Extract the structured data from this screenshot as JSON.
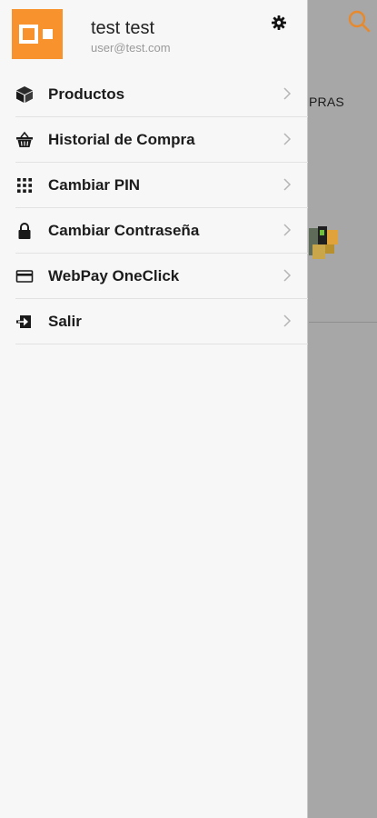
{
  "user": {
    "name": "test test",
    "email": "user@test.com"
  },
  "menu": [
    {
      "label": "Productos",
      "icon": "cube-icon"
    },
    {
      "label": "Historial de Compra",
      "icon": "basket-icon"
    },
    {
      "label": "Cambiar PIN",
      "icon": "keypad-icon"
    },
    {
      "label": "Cambiar Contraseña",
      "icon": "lock-icon"
    },
    {
      "label": "WebPay OneClick",
      "icon": "credit-card-icon"
    },
    {
      "label": "Salir",
      "icon": "exit-icon"
    }
  ],
  "background": {
    "partial_text": "PRAS"
  },
  "colors": {
    "accent": "#f7922c",
    "drawer_bg": "#f7f7f7",
    "overlay": "#a7a7a7"
  }
}
